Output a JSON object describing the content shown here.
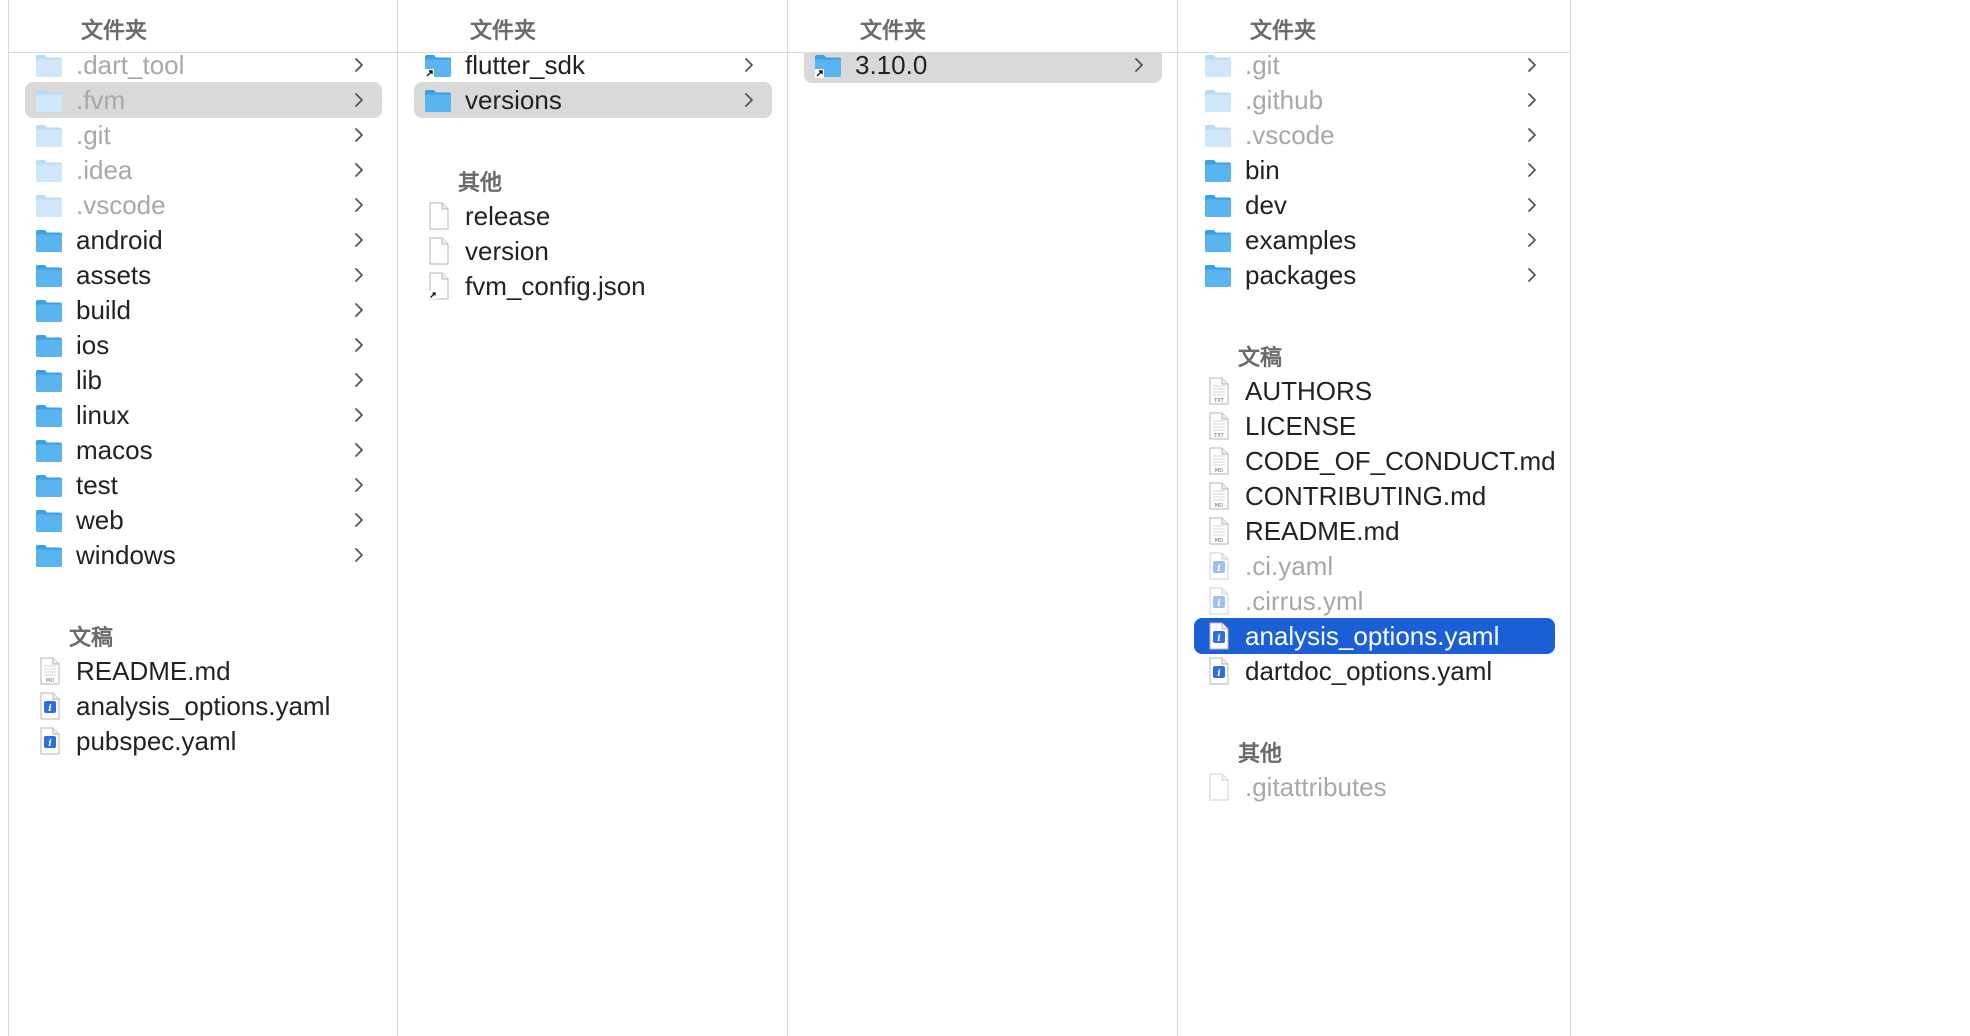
{
  "columns": [
    {
      "header": "文件夹",
      "sections": [
        {
          "title": "",
          "items": [
            {
              "name": ".dart_tool",
              "kind": "folder",
              "dim": true,
              "chevron": true
            },
            {
              "name": ".fvm",
              "kind": "folder",
              "dim": true,
              "chevron": true,
              "selected": "gray"
            },
            {
              "name": ".git",
              "kind": "folder",
              "dim": true,
              "chevron": true
            },
            {
              "name": ".idea",
              "kind": "folder",
              "dim": true,
              "chevron": true
            },
            {
              "name": ".vscode",
              "kind": "folder",
              "dim": true,
              "chevron": true
            },
            {
              "name": "android",
              "kind": "folder",
              "chevron": true
            },
            {
              "name": "assets",
              "kind": "folder",
              "chevron": true
            },
            {
              "name": "build",
              "kind": "folder",
              "chevron": true
            },
            {
              "name": "ios",
              "kind": "folder",
              "chevron": true
            },
            {
              "name": "lib",
              "kind": "folder",
              "chevron": true
            },
            {
              "name": "linux",
              "kind": "folder",
              "chevron": true
            },
            {
              "name": "macos",
              "kind": "folder",
              "chevron": true
            },
            {
              "name": "test",
              "kind": "folder",
              "chevron": true
            },
            {
              "name": "web",
              "kind": "folder",
              "chevron": true
            },
            {
              "name": "windows",
              "kind": "folder",
              "chevron": true
            }
          ]
        },
        {
          "title": "文稿",
          "items": [
            {
              "name": "README.md",
              "kind": "doc-md"
            },
            {
              "name": "analysis_options.yaml",
              "kind": "yaml"
            },
            {
              "name": "pubspec.yaml",
              "kind": "yaml"
            }
          ]
        },
        {
          "title": "",
          "items": []
        }
      ]
    },
    {
      "header": "文件夹",
      "sections": [
        {
          "title": "",
          "items": [
            {
              "name": "flutter_sdk",
              "kind": "folder-alias",
              "chevron": true
            },
            {
              "name": "versions",
              "kind": "folder",
              "chevron": true,
              "selected": "gray"
            }
          ]
        },
        {
          "title": "其他",
          "items": [
            {
              "name": "release",
              "kind": "blank"
            },
            {
              "name": "version",
              "kind": "blank"
            },
            {
              "name": "fvm_config.json",
              "kind": "blank-alias"
            }
          ]
        }
      ]
    },
    {
      "header": "文件夹",
      "sections": [
        {
          "title": "",
          "items": [
            {
              "name": "3.10.0",
              "kind": "folder-alias",
              "chevron": true,
              "selected": "gray"
            }
          ]
        }
      ]
    },
    {
      "header": "文件夹",
      "sections": [
        {
          "title": "",
          "items": [
            {
              "name": ".git",
              "kind": "folder",
              "dim": true,
              "chevron": true
            },
            {
              "name": ".github",
              "kind": "folder",
              "dim": true,
              "chevron": true
            },
            {
              "name": ".vscode",
              "kind": "folder",
              "dim": true,
              "chevron": true
            },
            {
              "name": "bin",
              "kind": "folder",
              "chevron": true
            },
            {
              "name": "dev",
              "kind": "folder",
              "chevron": true
            },
            {
              "name": "examples",
              "kind": "folder",
              "chevron": true
            },
            {
              "name": "packages",
              "kind": "folder",
              "chevron": true
            }
          ]
        },
        {
          "title": "文稿",
          "items": [
            {
              "name": "AUTHORS",
              "kind": "doc-txt"
            },
            {
              "name": "LICENSE",
              "kind": "doc-txt"
            },
            {
              "name": "CODE_OF_CONDUCT.md",
              "kind": "doc-md"
            },
            {
              "name": "CONTRIBUTING.md",
              "kind": "doc-md"
            },
            {
              "name": "README.md",
              "kind": "doc-md"
            },
            {
              "name": ".ci.yaml",
              "kind": "yaml",
              "dim": true
            },
            {
              "name": ".cirrus.yml",
              "kind": "yaml",
              "dim": true
            },
            {
              "name": "analysis_options.yaml",
              "kind": "yaml",
              "selected": "blue"
            },
            {
              "name": "dartdoc_options.yaml",
              "kind": "yaml"
            }
          ]
        },
        {
          "title": "其他",
          "items": [
            {
              "name": ".gitattributes",
              "kind": "blank",
              "dim": true
            }
          ]
        }
      ]
    }
  ],
  "icon_names": {
    "folder": "folder-icon",
    "folder-alias": "folder-alias-icon",
    "doc-md": "markdown-document-icon",
    "doc-txt": "text-document-icon",
    "yaml": "yaml-document-icon",
    "blank": "blank-document-icon",
    "blank-alias": "blank-document-alias-icon"
  },
  "colors": {
    "folder_blue": "#5ab4f0",
    "selection_blue": "#1a5fd6",
    "selection_gray": "#d9d9d9",
    "dim_text": "#a8a8a8"
  }
}
